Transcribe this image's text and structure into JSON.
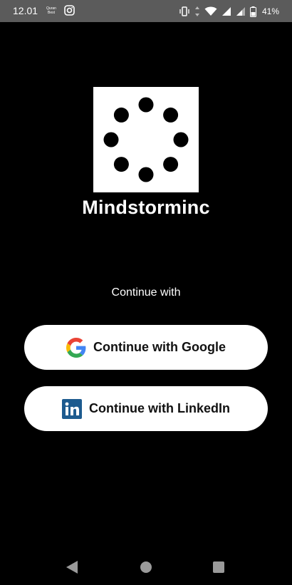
{
  "status_bar": {
    "time": "12.01",
    "quran_badge": "Quran Best",
    "battery": "41%",
    "icons": [
      "quran-icon",
      "instagram-icon",
      "vibrate-icon",
      "data-arrows-icon",
      "wifi-icon",
      "signal-icon",
      "signal-icon",
      "battery-icon"
    ]
  },
  "app": {
    "name": "Mindstorminc",
    "logo_icon": "dots-circle-logo"
  },
  "auth": {
    "prompt": "Continue with",
    "google_label": "Continue with Google",
    "linkedin_label": "Continue with LinkedIn"
  },
  "nav": {
    "icons": [
      "back-icon",
      "home-icon",
      "recents-icon"
    ]
  },
  "colors": {
    "background": "#000000",
    "status_bar": "#5b5b5b",
    "button": "#ffffff",
    "linkedin": "#1d5b8f"
  }
}
